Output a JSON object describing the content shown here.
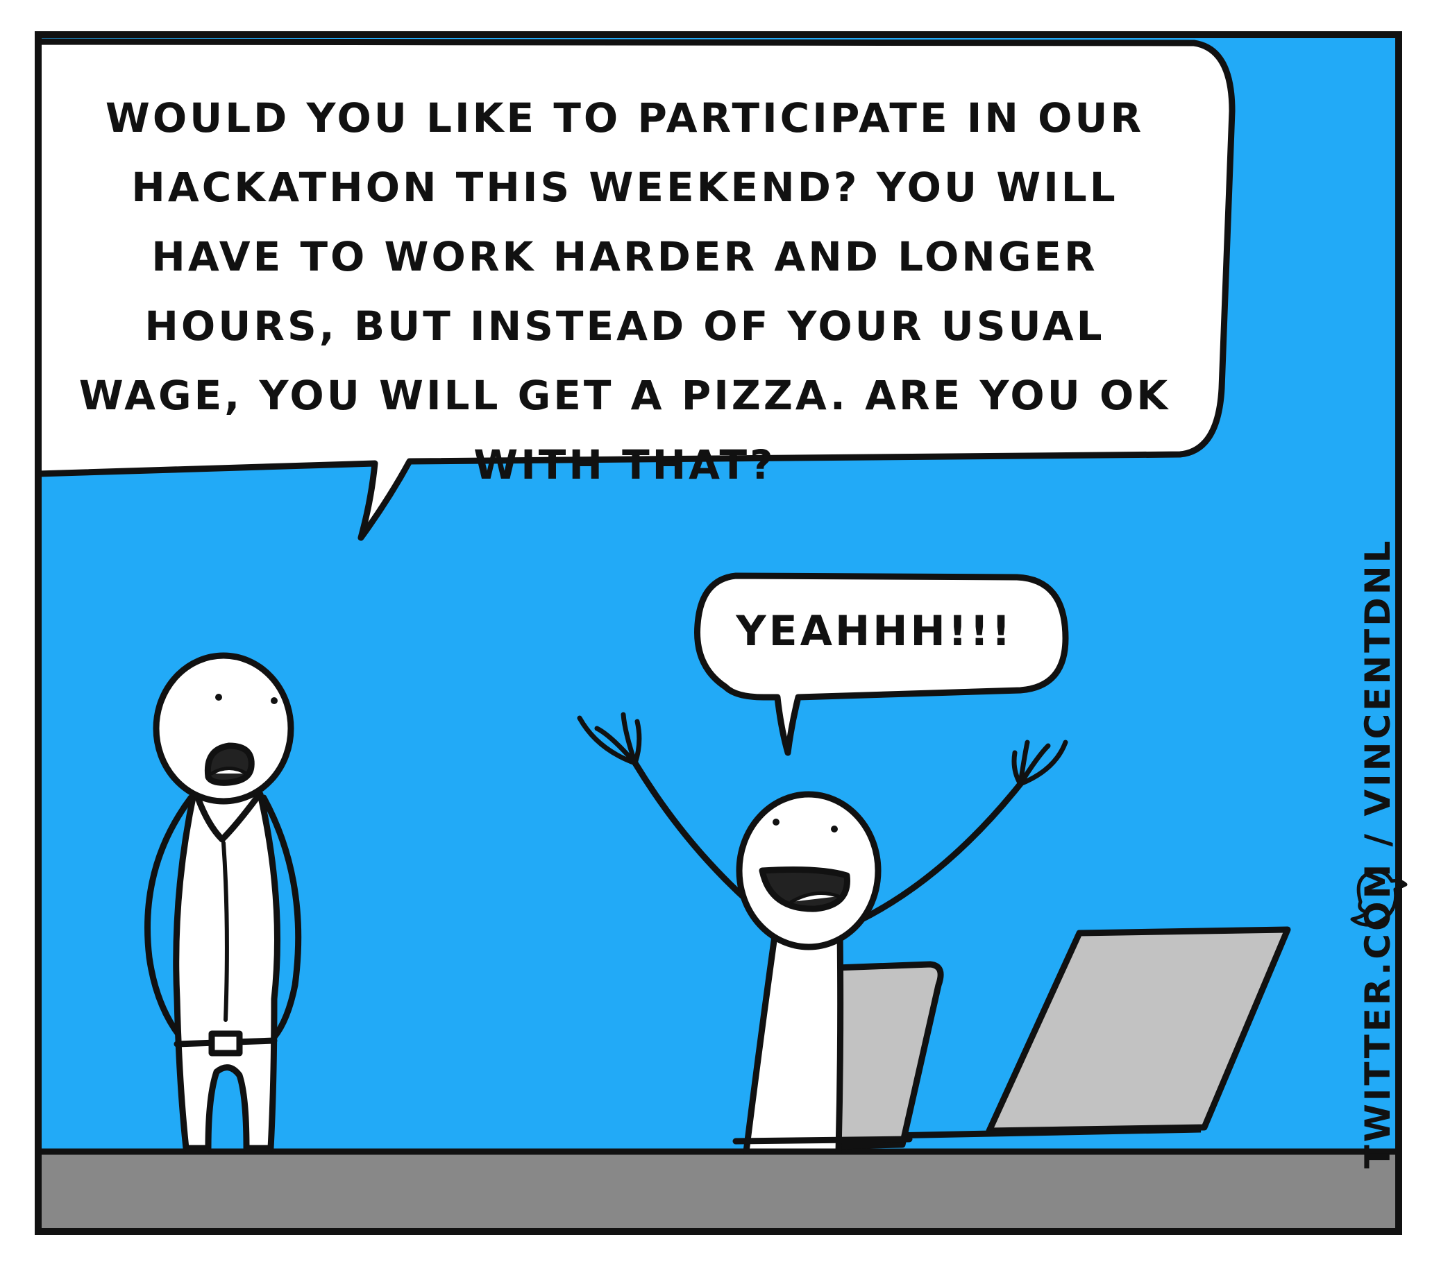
{
  "comic": {
    "boss_speech": "WOULD YOU LIKE TO PARTICIPATE IN OUR HACKATHON THIS WEEKEND? YOU WILL HAVE TO WORK HARDER AND LONGER HOURS, BUT INSTEAD OF YOUR USUAL WAGE, YOU WILL GET A PIZZA. ARE YOU OK WITH THAT?",
    "employee_speech": "YEAHHH!!!",
    "credit": "TWITTER.COM / VINCENTDNL"
  },
  "colors": {
    "background": "#22aaf7",
    "floor": "#888888",
    "outline": "#111111",
    "bubble": "#ffffff",
    "laptop": "#c2c2c2",
    "bird_icon": "#22aaf7"
  },
  "icons": [
    "twitter-bird-icon"
  ]
}
